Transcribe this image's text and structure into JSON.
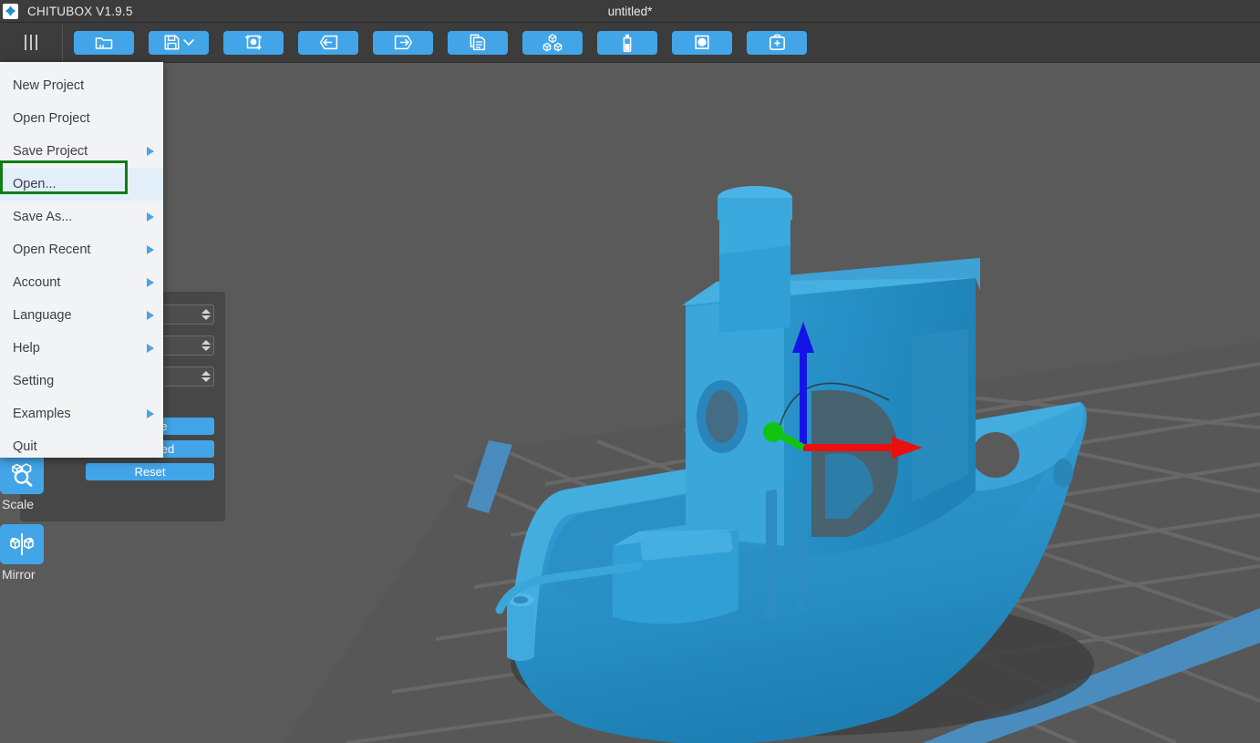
{
  "titlebar": {
    "logo_icon": "chitubox-diamond-logo",
    "app_title": "CHITUBOX V1.9.5",
    "document_title": "untitled*"
  },
  "toolbar": {
    "menu_icon": "hamburger-menu-icon",
    "buttons": [
      {
        "name": "open-file-button",
        "icon": "folder-open-icon"
      },
      {
        "name": "save-file-button",
        "icon": "floppy-disk-icon",
        "has_dropdown": true
      },
      {
        "name": "plate-settings-button",
        "icon": "plate-object-icon"
      },
      {
        "name": "undo-button",
        "icon": "arrow-left-in-box-icon"
      },
      {
        "name": "redo-button",
        "icon": "arrow-right-out-box-icon"
      },
      {
        "name": "duplicate-button",
        "icon": "copy-pages-icon"
      },
      {
        "name": "arrange-button",
        "icon": "cubes-arrange-icon"
      },
      {
        "name": "resin-button",
        "icon": "resin-bottle-icon"
      },
      {
        "name": "hollow-button",
        "icon": "hollow-circle-icon"
      },
      {
        "name": "support-button",
        "icon": "add-support-icon"
      }
    ]
  },
  "rail": {
    "items": [
      {
        "name": "scale-tool",
        "icon": "scale-magnifier-cube-icon",
        "label": "Scale"
      },
      {
        "name": "mirror-tool",
        "icon": "mirror-cubes-icon",
        "label": "Mirror"
      }
    ]
  },
  "panel": {
    "spinner_count": 3,
    "buttons": [
      {
        "name": "rotate-button",
        "label": "Rotate"
      },
      {
        "name": "centered-button",
        "label": "Centered"
      },
      {
        "name": "reset-button",
        "label": "Reset"
      }
    ]
  },
  "menu": {
    "items": [
      {
        "label": "New Project",
        "submenu": false,
        "active": false
      },
      {
        "label": "Open Project",
        "submenu": false,
        "active": false
      },
      {
        "label": "Save Project",
        "submenu": true,
        "active": false
      },
      {
        "label": "Open...",
        "submenu": false,
        "active": true
      },
      {
        "label": "Save As...",
        "submenu": true,
        "active": false
      },
      {
        "label": "Open Recent",
        "submenu": true,
        "active": false
      },
      {
        "label": "Account",
        "submenu": true,
        "active": false
      },
      {
        "label": "Language",
        "submenu": true,
        "active": false
      },
      {
        "label": "Help",
        "submenu": true,
        "active": false
      },
      {
        "label": "Setting",
        "submenu": false,
        "active": false
      },
      {
        "label": "Examples",
        "submenu": true,
        "active": false
      },
      {
        "label": "Quit",
        "submenu": false,
        "active": false
      }
    ],
    "highlight_target": "Open..."
  },
  "viewport": {
    "model_name": "3dbenchy-boat",
    "gizmo": {
      "z_axis_color": "#1414e6",
      "x_axis_color": "#e81010",
      "y_axis_color": "#11c411"
    }
  },
  "colors": {
    "accent": "#42a5e8",
    "titlebar_bg": "#3c3c3c",
    "viewport_bg": "#5a5a5a",
    "menu_bg": "#f2f3f5",
    "menu_hover": "#e3eefb",
    "highlight_border": "#127c16",
    "model_blue": "#2d9ed8",
    "plate_edge": "#4a8cbd"
  }
}
